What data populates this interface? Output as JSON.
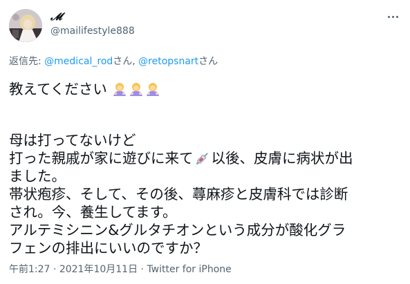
{
  "author": {
    "display_name": "𝓜",
    "handle": "@mailifestyle888"
  },
  "menu_icon": "more-horizontal-icon",
  "reply_to": {
    "prefix": "返信先: ",
    "mention1": "@medical_rod",
    "suffix1": "さん, ",
    "mention2": "@retopsnart",
    "suffix2": "さん"
  },
  "tweet": {
    "line1": "教えてください",
    "line1_emoji": "person-bowing-emoji x3",
    "line2": "母は打ってないけど",
    "line3_a": "打った親戚が家に遊びに来て",
    "line3_emoji": "syringe-emoji",
    "line3_b": "以後、皮膚に病状が出",
    "line4": "ました。",
    "line5": "帯状疱疹、そして、その後、蕁麻疹と皮膚科では診断",
    "line6": "され。今、養生してます。",
    "line7": "アルテミシニン&グルタチオンという成分が酸化グラ",
    "line8": "フェンの排出にいいのですか？"
  },
  "meta": {
    "time": "午前1:27",
    "sep1": " · ",
    "date": "2021年10月11日",
    "sep2": " · ",
    "source": "Twitter for iPhone"
  },
  "colors": {
    "link": "#1d9bf0",
    "secondary_text": "#536471",
    "primary_text": "#0f1419"
  }
}
